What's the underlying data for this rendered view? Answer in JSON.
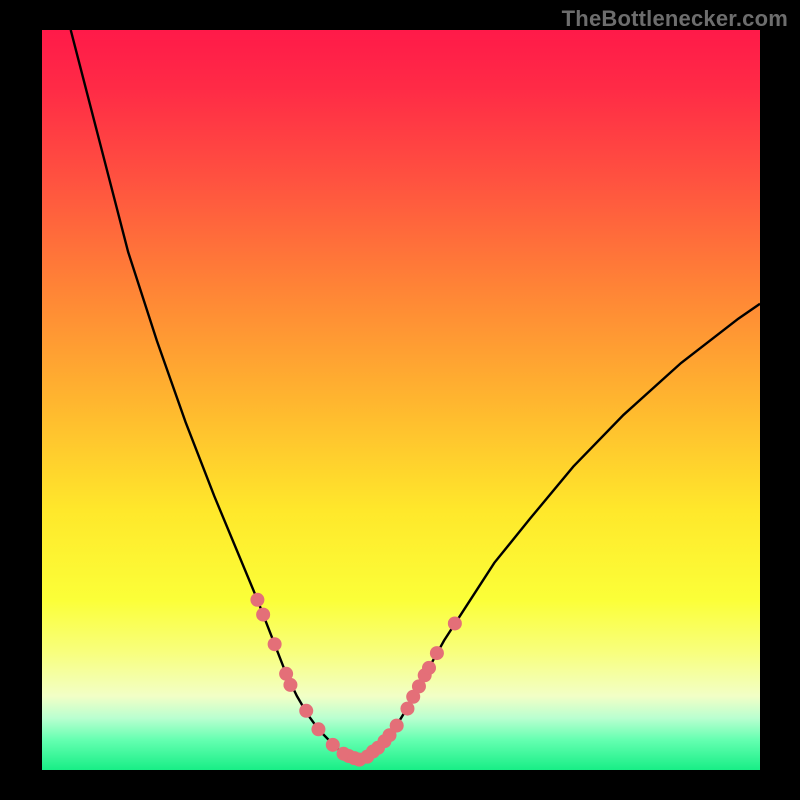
{
  "watermark": "TheBottlenecker.com",
  "colors": {
    "curve": "#000000",
    "marker": "#e46f78",
    "frame": "#000000"
  },
  "chart_data": {
    "type": "line",
    "title": "",
    "xlabel": "",
    "ylabel": "",
    "xlim": [
      0,
      100
    ],
    "ylim": [
      0,
      100
    ],
    "series": [
      {
        "name": "left-branch",
        "x": [
          4,
          8,
          12,
          16,
          20,
          24,
          27,
          30,
          32,
          34,
          35.5,
          37,
          38.5,
          40,
          41,
          42,
          43,
          44
        ],
        "y": [
          100,
          85,
          70,
          58,
          47,
          37,
          30,
          23,
          18,
          13,
          10,
          7.5,
          5.5,
          4,
          3,
          2.2,
          1.7,
          1.4
        ]
      },
      {
        "name": "right-branch",
        "x": [
          44,
          45,
          46,
          47.5,
          49,
          50.5,
          52,
          54,
          56,
          59,
          63,
          68,
          74,
          81,
          89,
          97,
          100
        ],
        "y": [
          1.4,
          1.7,
          2.4,
          3.6,
          5.4,
          7.8,
          10.5,
          14,
          17.5,
          22,
          28,
          34,
          41,
          48,
          55,
          61,
          63
        ]
      }
    ],
    "markers": [
      {
        "x": 30.0,
        "y": 23
      },
      {
        "x": 30.8,
        "y": 21
      },
      {
        "x": 32.4,
        "y": 17
      },
      {
        "x": 34.0,
        "y": 13
      },
      {
        "x": 34.6,
        "y": 11.5
      },
      {
        "x": 36.8,
        "y": 8
      },
      {
        "x": 38.5,
        "y": 5.5
      },
      {
        "x": 40.5,
        "y": 3.4
      },
      {
        "x": 42.0,
        "y": 2.2
      },
      {
        "x": 42.7,
        "y": 1.9
      },
      {
        "x": 43.5,
        "y": 1.6
      },
      {
        "x": 44.2,
        "y": 1.4
      },
      {
        "x": 45.3,
        "y": 1.8
      },
      {
        "x": 46.1,
        "y": 2.5
      },
      {
        "x": 46.8,
        "y": 3.0
      },
      {
        "x": 47.7,
        "y": 3.9
      },
      {
        "x": 48.4,
        "y": 4.7
      },
      {
        "x": 49.4,
        "y": 6.0
      },
      {
        "x": 50.9,
        "y": 8.3
      },
      {
        "x": 51.7,
        "y": 9.9
      },
      {
        "x": 52.5,
        "y": 11.3
      },
      {
        "x": 53.3,
        "y": 12.8
      },
      {
        "x": 53.9,
        "y": 13.8
      },
      {
        "x": 55.0,
        "y": 15.8
      },
      {
        "x": 57.5,
        "y": 19.8
      }
    ],
    "marker_style": {
      "radius_px": 7,
      "color": "#e46f78"
    }
  }
}
